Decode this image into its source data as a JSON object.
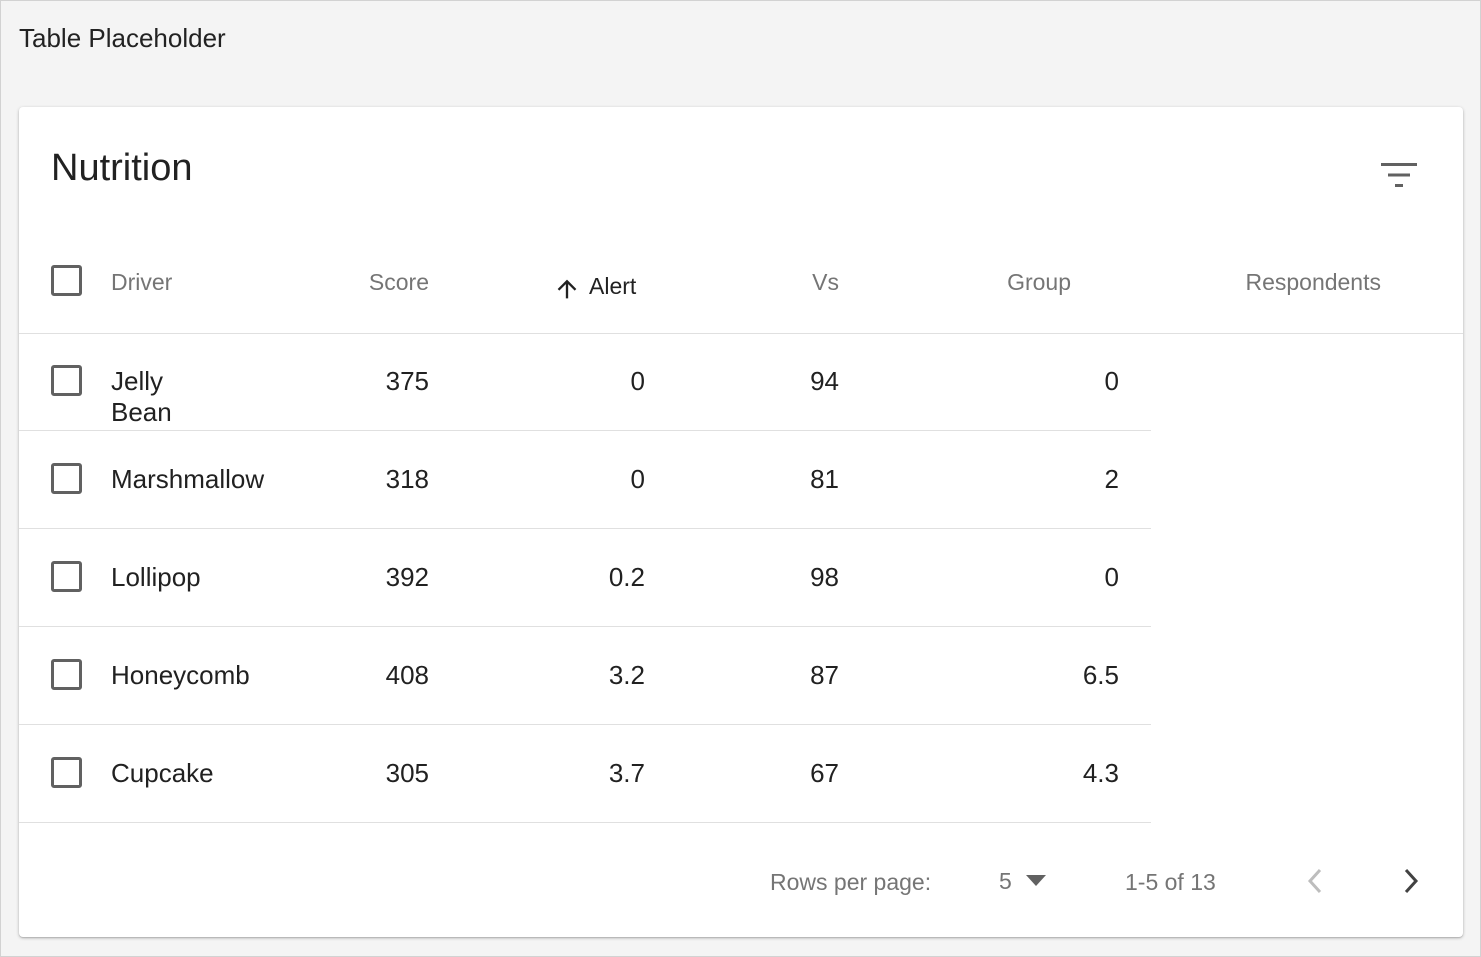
{
  "page_label": "Table Placeholder",
  "table": {
    "title": "Nutrition",
    "columns": {
      "driver": "Driver",
      "score": "Score",
      "alert": "Alert",
      "vs": "Vs",
      "group": "Group",
      "respondents": "Respondents"
    },
    "sort": {
      "column": "Alert",
      "direction": "ascending",
      "icon": "arrow-up-icon"
    },
    "rows": [
      {
        "driver": "Jelly Bean",
        "score": "375",
        "alert": "0",
        "vs": "94",
        "group": "0"
      },
      {
        "driver": "Marshmallow",
        "score": "318",
        "alert": "0",
        "vs": "81",
        "group": "2"
      },
      {
        "driver": "Lollipop",
        "score": "392",
        "alert": "0.2",
        "vs": "98",
        "group": "0"
      },
      {
        "driver": "Honeycomb",
        "score": "408",
        "alert": "3.2",
        "vs": "87",
        "group": "6.5"
      },
      {
        "driver": "Cupcake",
        "score": "305",
        "alert": "3.7",
        "vs": "67",
        "group": "4.3"
      }
    ]
  },
  "pagination": {
    "rows_per_page_label": "Rows per page:",
    "rows_per_page_value": "5",
    "range_text": "1-5 of 13",
    "prev_icon": "chevron-left-icon",
    "next_icon": "chevron-right-icon"
  },
  "icons": {
    "filter": "filter-list-icon",
    "dropdown": "caret-down-icon"
  },
  "colors": {
    "page_bg": "#f4f4f4",
    "card_bg": "#ffffff",
    "header_text": "#757575",
    "divider": "#e0e0e0"
  }
}
